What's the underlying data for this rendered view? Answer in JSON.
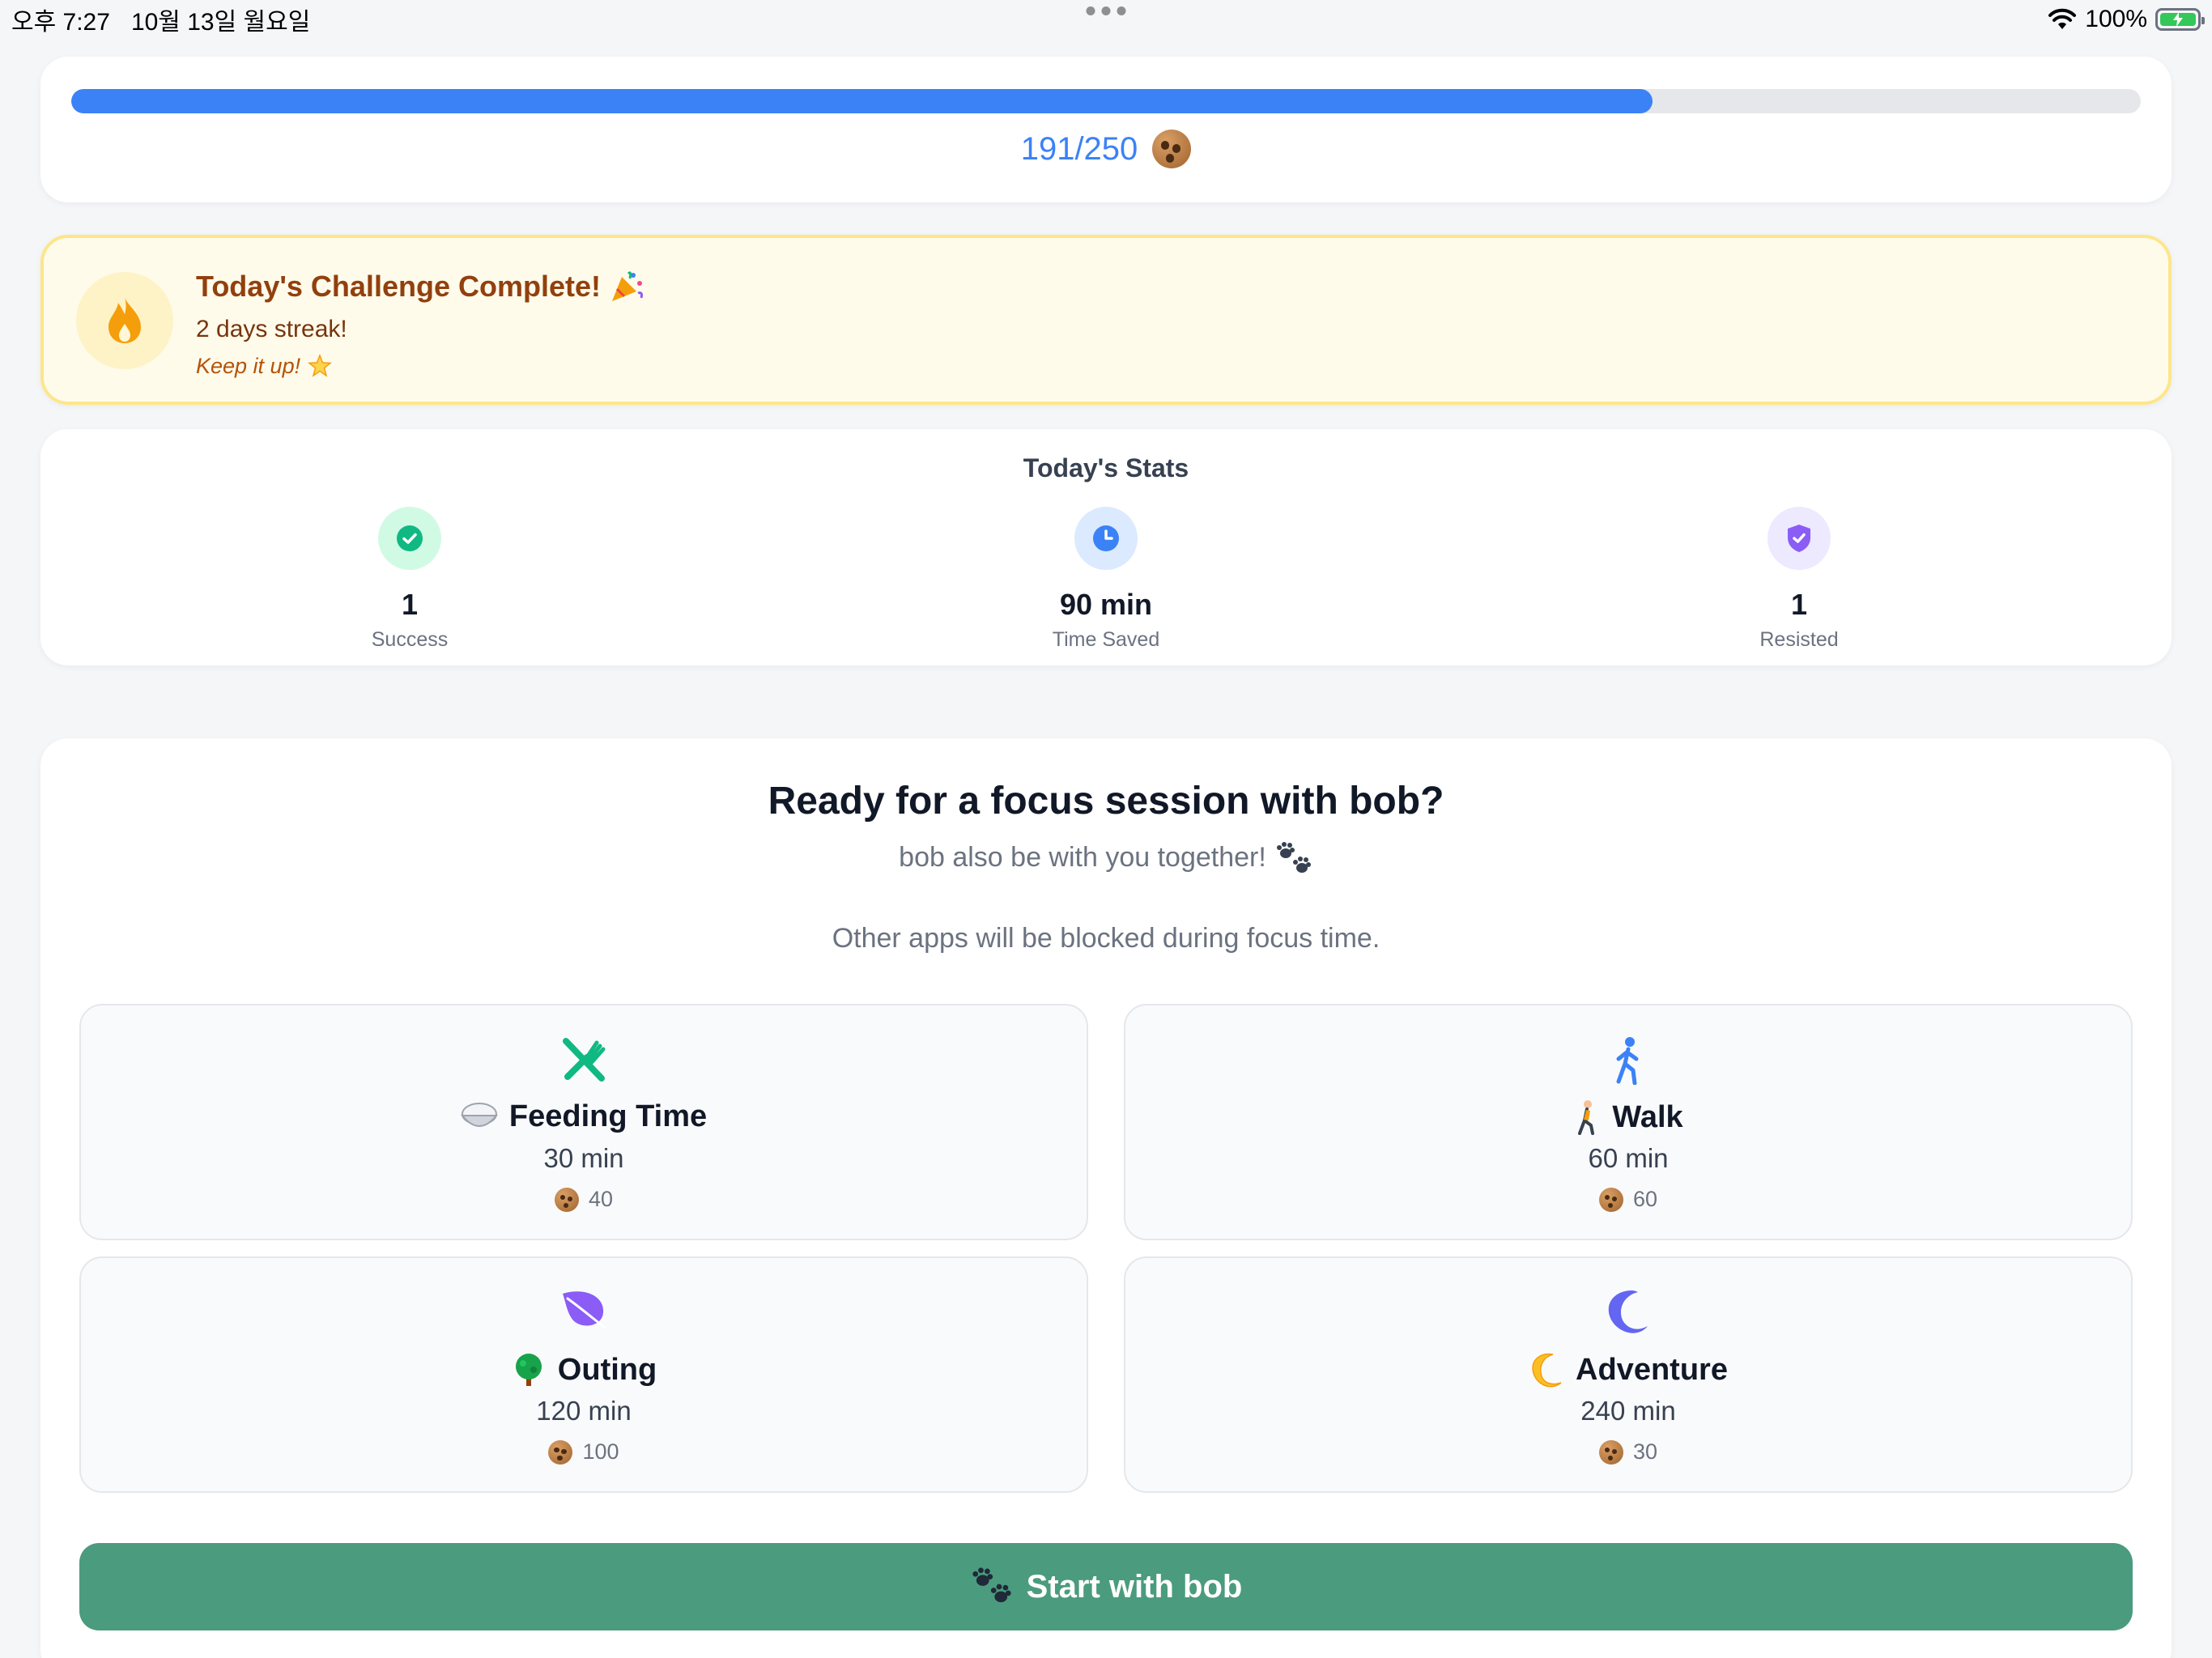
{
  "status_bar": {
    "time": "오후 7:27",
    "date": "10월 13일 월요일",
    "battery": "100%"
  },
  "progress": {
    "current": 191,
    "goal": 250,
    "fraction": 0.764,
    "label": "191/250",
    "icon": "cookie-icon"
  },
  "challenge": {
    "title": "Today's Challenge Complete!",
    "streak": "2 days streak!",
    "keep": "Keep it up!",
    "icon": "flame-icon"
  },
  "stats": {
    "title": "Today's Stats",
    "items": [
      {
        "value": "1",
        "label": "Success",
        "icon": "check-circle-icon",
        "color": "#10b981",
        "bg": "#d1fae5"
      },
      {
        "value": "90 min",
        "label": "Time Saved",
        "icon": "clock-icon",
        "color": "#3b82f6",
        "bg": "#dbeafe"
      },
      {
        "value": "1",
        "label": "Resisted",
        "icon": "shield-check-icon",
        "color": "#8b5cf6",
        "bg": "#ede9fe"
      }
    ]
  },
  "session": {
    "title": "Ready for a focus session with bob?",
    "subtitle": "bob also be with you together!",
    "note": "Other apps will be blocked during focus time.",
    "options": [
      {
        "name": "Feeding Time",
        "duration": "30 min",
        "reward": "40",
        "icon": "fork-knife-icon",
        "emoji": "rice-bowl-icon",
        "color": "#10b981"
      },
      {
        "name": "Walk",
        "duration": "60 min",
        "reward": "60",
        "icon": "walking-person-icon",
        "emoji": "walking-person-emoji",
        "color": "#3b82f6"
      },
      {
        "name": "Outing",
        "duration": "120 min",
        "reward": "100",
        "icon": "leaf-icon",
        "emoji": "tree-icon",
        "color": "#8b5cf6"
      },
      {
        "name": "Adventure",
        "duration": "240 min",
        "reward": "30",
        "icon": "moon-icon",
        "emoji": "crescent-moon-icon",
        "color": "#6366f1"
      }
    ],
    "start_label": "Start with bob"
  }
}
